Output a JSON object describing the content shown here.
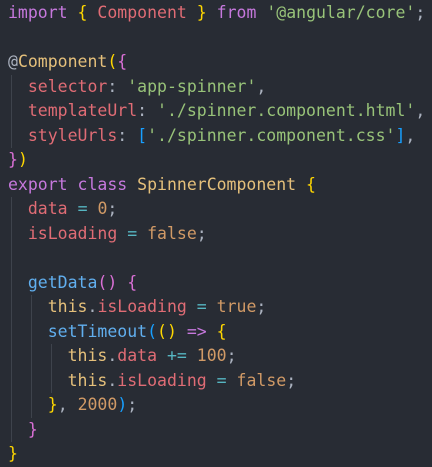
{
  "colors": {
    "background": "#282c34",
    "keyword": "#c678dd",
    "class_name": "#e5c07b",
    "string": "#98c379",
    "property": "#e06c75",
    "number": "#d19a66",
    "function": "#61afef",
    "operator": "#56b6c2",
    "punctuation": "#abb2bf",
    "bracket_gold": "#ffd700",
    "bracket_violet": "#da70d6",
    "bracket_blue": "#179fff"
  },
  "editor": {
    "lines": [
      {
        "indent": 0,
        "tokens": [
          {
            "t": "import",
            "c": "keyword"
          },
          {
            "t": " ",
            "c": "punctuation"
          },
          {
            "t": "{",
            "c": "bracket_gold"
          },
          {
            "t": " ",
            "c": "punctuation"
          },
          {
            "t": "Component",
            "c": "property"
          },
          {
            "t": " ",
            "c": "punctuation"
          },
          {
            "t": "}",
            "c": "bracket_gold"
          },
          {
            "t": " ",
            "c": "punctuation"
          },
          {
            "t": "from",
            "c": "keyword"
          },
          {
            "t": " ",
            "c": "punctuation"
          },
          {
            "t": "'@angular/core'",
            "c": "string"
          },
          {
            "t": ";",
            "c": "punctuation"
          }
        ]
      },
      {
        "indent": 0,
        "tokens": []
      },
      {
        "indent": 0,
        "tokens": [
          {
            "t": "@",
            "c": "punctuation"
          },
          {
            "t": "Component",
            "c": "class_name"
          },
          {
            "t": "(",
            "c": "bracket_gold"
          },
          {
            "t": "{",
            "c": "bracket_violet"
          }
        ]
      },
      {
        "indent": 1,
        "tokens": [
          {
            "t": "selector",
            "c": "property"
          },
          {
            "t": ": ",
            "c": "punctuation"
          },
          {
            "t": "'app-spinner'",
            "c": "string"
          },
          {
            "t": ",",
            "c": "punctuation"
          }
        ]
      },
      {
        "indent": 1,
        "tokens": [
          {
            "t": "templateUrl",
            "c": "property"
          },
          {
            "t": ": ",
            "c": "punctuation"
          },
          {
            "t": "'./spinner.component.html'",
            "c": "string"
          },
          {
            "t": ",",
            "c": "punctuation"
          }
        ]
      },
      {
        "indent": 1,
        "tokens": [
          {
            "t": "styleUrls",
            "c": "property"
          },
          {
            "t": ": ",
            "c": "punctuation"
          },
          {
            "t": "[",
            "c": "bracket_blue"
          },
          {
            "t": "'./spinner.component.css'",
            "c": "string"
          },
          {
            "t": "]",
            "c": "bracket_blue"
          },
          {
            "t": ",",
            "c": "punctuation"
          }
        ]
      },
      {
        "indent": 0,
        "tokens": [
          {
            "t": "}",
            "c": "bracket_violet"
          },
          {
            "t": ")",
            "c": "bracket_gold"
          }
        ]
      },
      {
        "indent": 0,
        "tokens": [
          {
            "t": "export",
            "c": "keyword"
          },
          {
            "t": " ",
            "c": "punctuation"
          },
          {
            "t": "class",
            "c": "keyword"
          },
          {
            "t": " ",
            "c": "punctuation"
          },
          {
            "t": "SpinnerComponent",
            "c": "class_name"
          },
          {
            "t": " ",
            "c": "punctuation"
          },
          {
            "t": "{",
            "c": "bracket_gold"
          }
        ]
      },
      {
        "indent": 1,
        "tokens": [
          {
            "t": "data",
            "c": "property"
          },
          {
            "t": " ",
            "c": "punctuation"
          },
          {
            "t": "=",
            "c": "operator"
          },
          {
            "t": " ",
            "c": "punctuation"
          },
          {
            "t": "0",
            "c": "number"
          },
          {
            "t": ";",
            "c": "punctuation"
          }
        ]
      },
      {
        "indent": 1,
        "tokens": [
          {
            "t": "isLoading",
            "c": "property"
          },
          {
            "t": " ",
            "c": "punctuation"
          },
          {
            "t": "=",
            "c": "operator"
          },
          {
            "t": " ",
            "c": "punctuation"
          },
          {
            "t": "false",
            "c": "number"
          },
          {
            "t": ";",
            "c": "punctuation"
          }
        ]
      },
      {
        "indent": 1,
        "tokens": []
      },
      {
        "indent": 1,
        "tokens": [
          {
            "t": "getData",
            "c": "function"
          },
          {
            "t": "(",
            "c": "bracket_violet"
          },
          {
            "t": ")",
            "c": "bracket_violet"
          },
          {
            "t": " ",
            "c": "punctuation"
          },
          {
            "t": "{",
            "c": "bracket_violet"
          }
        ]
      },
      {
        "indent": 2,
        "tokens": [
          {
            "t": "this",
            "c": "class_name"
          },
          {
            "t": ".",
            "c": "punctuation"
          },
          {
            "t": "isLoading",
            "c": "property"
          },
          {
            "t": " ",
            "c": "punctuation"
          },
          {
            "t": "=",
            "c": "operator"
          },
          {
            "t": " ",
            "c": "punctuation"
          },
          {
            "t": "true",
            "c": "number"
          },
          {
            "t": ";",
            "c": "punctuation"
          }
        ]
      },
      {
        "indent": 2,
        "tokens": [
          {
            "t": "setTimeout",
            "c": "function"
          },
          {
            "t": "(",
            "c": "bracket_blue"
          },
          {
            "t": "(",
            "c": "bracket_gold"
          },
          {
            "t": ")",
            "c": "bracket_gold"
          },
          {
            "t": " ",
            "c": "punctuation"
          },
          {
            "t": "=>",
            "c": "keyword"
          },
          {
            "t": " ",
            "c": "punctuation"
          },
          {
            "t": "{",
            "c": "bracket_gold"
          }
        ]
      },
      {
        "indent": 3,
        "tokens": [
          {
            "t": "this",
            "c": "class_name"
          },
          {
            "t": ".",
            "c": "punctuation"
          },
          {
            "t": "data",
            "c": "property"
          },
          {
            "t": " ",
            "c": "punctuation"
          },
          {
            "t": "+=",
            "c": "operator"
          },
          {
            "t": " ",
            "c": "punctuation"
          },
          {
            "t": "100",
            "c": "number"
          },
          {
            "t": ";",
            "c": "punctuation"
          }
        ]
      },
      {
        "indent": 3,
        "tokens": [
          {
            "t": "this",
            "c": "class_name"
          },
          {
            "t": ".",
            "c": "punctuation"
          },
          {
            "t": "isLoading",
            "c": "property"
          },
          {
            "t": " ",
            "c": "punctuation"
          },
          {
            "t": "=",
            "c": "operator"
          },
          {
            "t": " ",
            "c": "punctuation"
          },
          {
            "t": "false",
            "c": "number"
          },
          {
            "t": ";",
            "c": "punctuation"
          }
        ]
      },
      {
        "indent": 2,
        "tokens": [
          {
            "t": "}",
            "c": "bracket_gold"
          },
          {
            "t": ", ",
            "c": "punctuation"
          },
          {
            "t": "2000",
            "c": "number"
          },
          {
            "t": ")",
            "c": "bracket_blue"
          },
          {
            "t": ";",
            "c": "punctuation"
          }
        ]
      },
      {
        "indent": 1,
        "tokens": [
          {
            "t": "}",
            "c": "bracket_violet"
          }
        ]
      },
      {
        "indent": 0,
        "tokens": [
          {
            "t": "}",
            "c": "bracket_gold"
          }
        ]
      }
    ]
  }
}
